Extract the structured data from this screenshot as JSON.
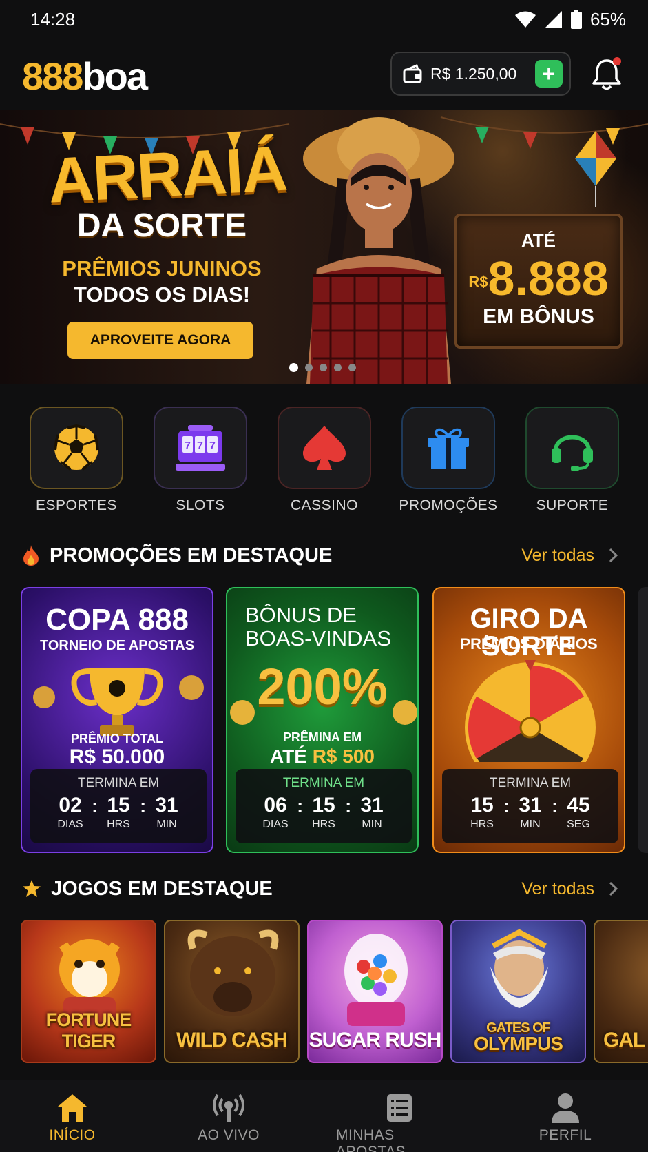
{
  "status": {
    "time": "14:28",
    "battery": "65%"
  },
  "header": {
    "logo_num": "888",
    "logo_word": "boa",
    "balance": "R$ 1.250,00",
    "deposit_icon": "plus-icon",
    "notification_icon": "bell-icon",
    "notification_badge_color": "#e53935"
  },
  "banner": {
    "title": "ARRAIÁ",
    "subtitle": "DA SORTE",
    "line1": "PRÊMIOS JUNINOS",
    "line2": "TODOS OS DIAS!",
    "cta": "APROVEITE AGORA",
    "board_top": "ATÉ",
    "board_currency": "R$",
    "board_amount": "8.888",
    "board_bottom": "EM BÔNUS",
    "slides": 5,
    "active_slide": 1
  },
  "categories": [
    {
      "label": "ESPORTES",
      "icon": "soccer-ball-icon",
      "color": "#f5b82e"
    },
    {
      "label": "SLOTS",
      "icon": "slot-machine-icon",
      "color": "#9b5cf6"
    },
    {
      "label": "CASSINO",
      "icon": "spade-icon",
      "color": "#e53935"
    },
    {
      "label": "PROMOÇÕES",
      "icon": "gift-icon",
      "color": "#2d8cf0"
    },
    {
      "label": "SUPORTE",
      "icon": "headset-icon",
      "color": "#2fbf5a"
    }
  ],
  "promos_section": {
    "title": "PROMOÇÕES EM DESTAQUE",
    "link": "Ver todas"
  },
  "promos": [
    {
      "title": "COPA 888",
      "subtitle": "TORNEIO DE APOSTAS",
      "prize_label": "PRÊMIO TOTAL",
      "prize_value": "R$ 50.000",
      "ends_label": "TERMINA EM",
      "timer": [
        {
          "num": "02",
          "unit": "DIAS"
        },
        {
          "num": "15",
          "unit": "HRS"
        },
        {
          "num": "31",
          "unit": "MIN"
        }
      ]
    },
    {
      "title": "BÔNUS DE",
      "title2": "BOAS-VINDAS",
      "big": "200%",
      "prize_label": "PRÊMINA EM",
      "prize_prefix": "ATÉ",
      "prize_value": "R$ 500",
      "ends_label": "TERMINA EM",
      "timer": [
        {
          "num": "06",
          "unit": "DIAS"
        },
        {
          "num": "15",
          "unit": "HRS"
        },
        {
          "num": "31",
          "unit": "MIN"
        }
      ]
    },
    {
      "title": "GIRO DA SORTE",
      "subtitle": "PRÊMIOS DIÁRIOS",
      "ends_label": "TERMINA EM",
      "timer": [
        {
          "num": "15",
          "unit": "HRS"
        },
        {
          "num": "31",
          "unit": "MIN"
        },
        {
          "num": "45",
          "unit": "SEG"
        }
      ]
    }
  ],
  "games_section": {
    "title": "JOGOS EM DESTAQUE",
    "link": "Ver todas"
  },
  "games": [
    {
      "title": "FORTUNE TIGER"
    },
    {
      "title": "WILD CASH"
    },
    {
      "title": "SUGAR RUSH"
    },
    {
      "title": "GATES OF",
      "title2": "OLYMPUS"
    },
    {
      "title": "GAL"
    }
  ],
  "nav": [
    {
      "label": "INÍCIO",
      "icon": "home-icon",
      "active": true
    },
    {
      "label": "AO VIVO",
      "icon": "live-broadcast-icon"
    },
    {
      "label": "MINHAS APOSTAS",
      "icon": "bet-list-icon"
    },
    {
      "label": "PERFIL",
      "icon": "user-icon"
    }
  ],
  "colors": {
    "accent": "#f5b82e",
    "background": "#0f0f10",
    "success": "#2fbf5a"
  }
}
